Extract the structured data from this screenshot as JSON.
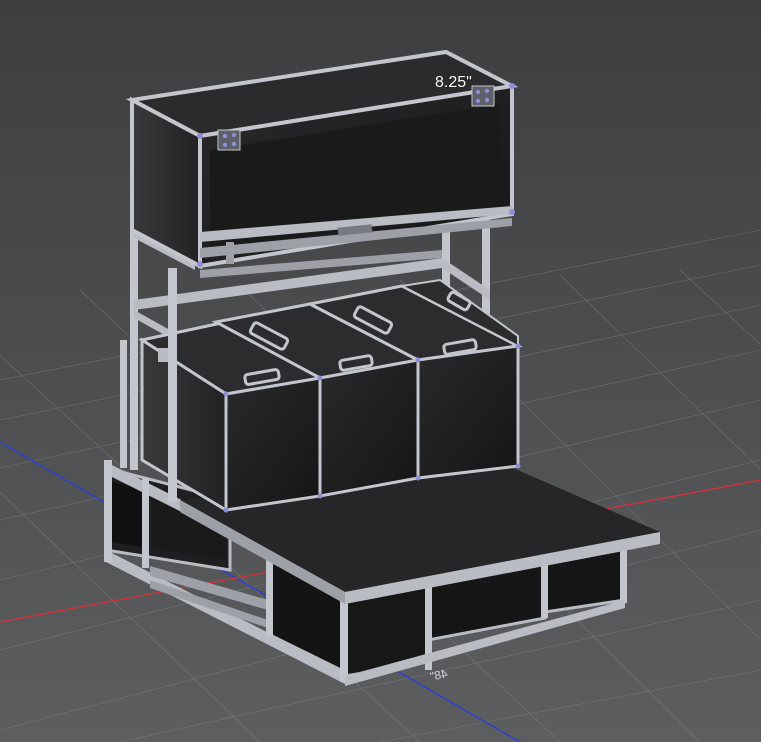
{
  "viewport": {
    "dimension_label": "8.25\"",
    "floor_label": "48\"",
    "colors": {
      "background_top": "#3c3e40",
      "background_bottom": "#5a5c5e",
      "grid": "#8a8c8e",
      "x_axis": "#d0343a",
      "y_axis": "#2b3fd6",
      "panel": "#1c1c1e",
      "frame": "#b9bcc2",
      "frame_shadow": "#7d8086",
      "connector": "#8d8fd8"
    }
  }
}
